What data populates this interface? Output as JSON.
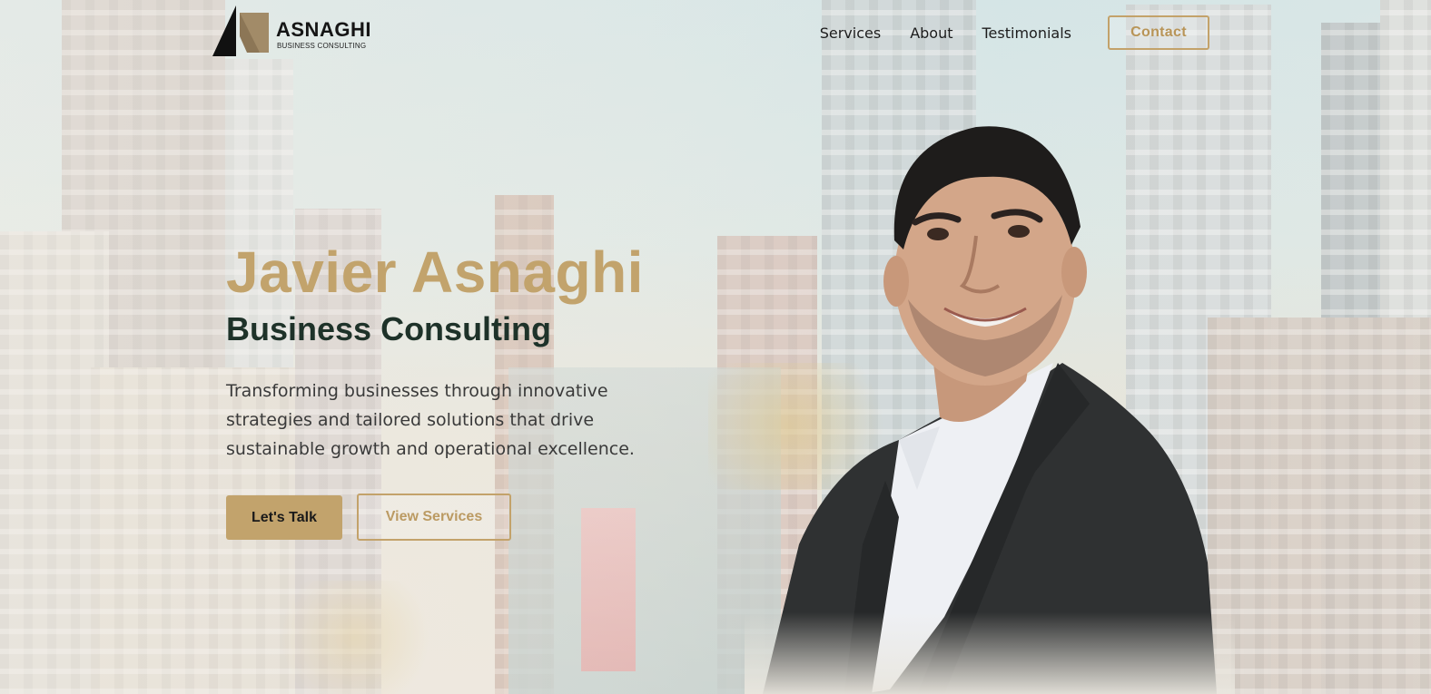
{
  "brand": {
    "name": "ASNAGHI",
    "tagline": "BUSINESS CONSULTING",
    "gold": "#c2a36c",
    "dark": "#1e3229"
  },
  "nav": {
    "links": [
      "Services",
      "About",
      "Testimonials"
    ],
    "contact_label": "Contact"
  },
  "hero": {
    "name": "Javier Asnaghi",
    "subtitle": "Business Consulting",
    "description": "Transforming businesses through innovative strategies and tailored solutions that drive sustainable growth and operational excellence.",
    "primary_cta": "Let's Talk",
    "secondary_cta": "View Services"
  },
  "icons": {
    "logo": "asnaghi-logo-icon",
    "portrait": "consultant-portrait-photo"
  }
}
